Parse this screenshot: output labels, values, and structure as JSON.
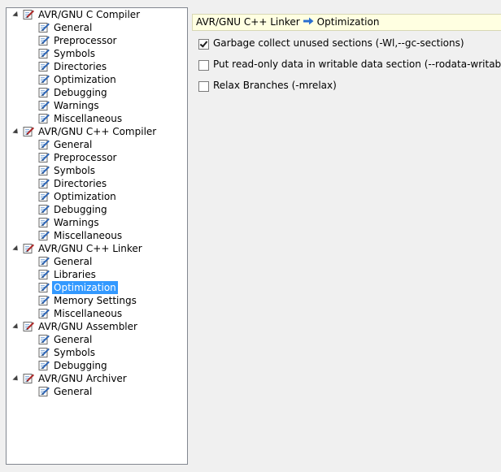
{
  "tree": {
    "groups": [
      {
        "label": "AVR/GNU C Compiler",
        "icon": "settings-icon",
        "children": [
          "General",
          "Preprocessor",
          "Symbols",
          "Directories",
          "Optimization",
          "Debugging",
          "Warnings",
          "Miscellaneous"
        ]
      },
      {
        "label": "AVR/GNU C++ Compiler",
        "icon": "settings-icon",
        "children": [
          "General",
          "Preprocessor",
          "Symbols",
          "Directories",
          "Optimization",
          "Debugging",
          "Warnings",
          "Miscellaneous"
        ]
      },
      {
        "label": "AVR/GNU C++ Linker",
        "icon": "settings-icon",
        "children": [
          "General",
          "Libraries",
          "Optimization",
          "Memory Settings",
          "Miscellaneous"
        ],
        "selected_child": "Optimization"
      },
      {
        "label": "AVR/GNU Assembler",
        "icon": "settings-icon",
        "children": [
          "General",
          "Symbols",
          "Debugging"
        ]
      },
      {
        "label": "AVR/GNU Archiver",
        "icon": "settings-icon",
        "children": [
          "General"
        ]
      }
    ]
  },
  "header": {
    "section": "AVR/GNU C++ Linker",
    "page": "Optimization"
  },
  "options": [
    {
      "label": "Garbage collect unused sections (-Wl,--gc-sections)",
      "checked": true
    },
    {
      "label": "Put read-only data in writable data section (--rodata-writable)",
      "checked": false
    },
    {
      "label": "Relax Branches (-mrelax)",
      "checked": false
    }
  ],
  "colors": {
    "selection": "#3399ff",
    "header_bg": "#ffffe1",
    "arrow": "#2a6fcf"
  }
}
